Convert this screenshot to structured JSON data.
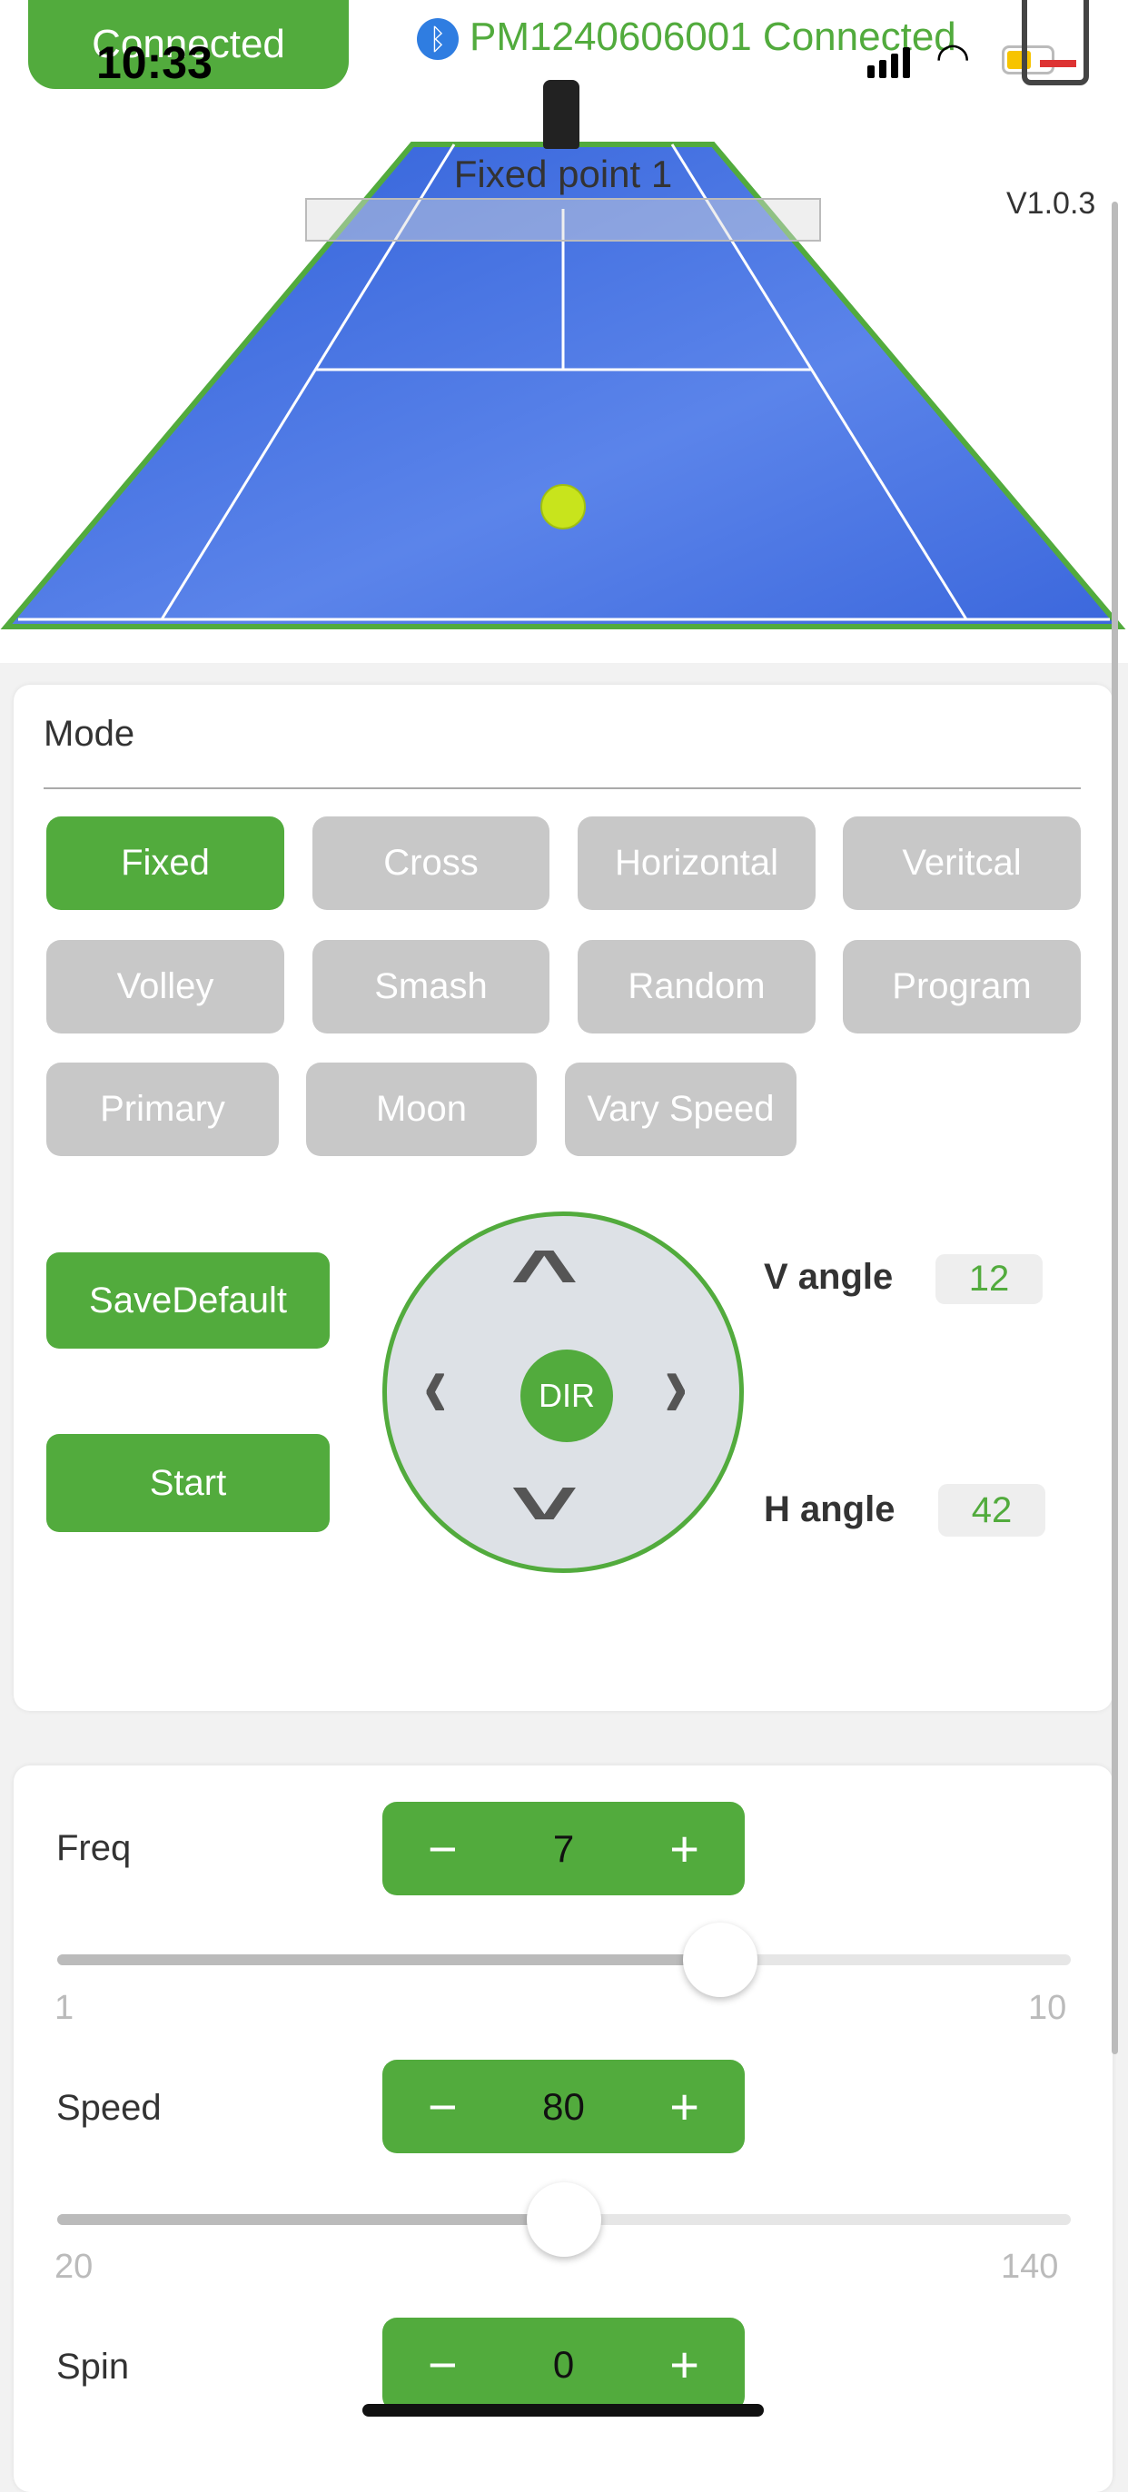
{
  "status_bar": {
    "time": "10:33",
    "battery_level": 0.45
  },
  "header": {
    "connect_button": "Connected",
    "device_status": "PM1240606001 Connected",
    "version": "V1.0.3"
  },
  "court": {
    "label": "Fixed point 1"
  },
  "mode": {
    "title": "Mode",
    "options": [
      "Fixed",
      "Cross",
      "Horizontal",
      "Veritcal",
      "Volley",
      "Smash",
      "Random",
      "Program",
      "Primary",
      "Moon",
      "Vary Speed"
    ],
    "selected": "Fixed"
  },
  "controls": {
    "save_default": "SaveDefault",
    "start": "Start",
    "dir": "DIR",
    "v_angle_label": "V angle",
    "v_angle": "12",
    "h_angle_label": "H angle",
    "h_angle": "42"
  },
  "params": [
    {
      "label": "Freq",
      "value": "7",
      "min": "1",
      "max": "10"
    },
    {
      "label": "Speed",
      "value": "80",
      "min": "20",
      "max": "140"
    },
    {
      "label": "Spin",
      "value": "0"
    }
  ],
  "colors": {
    "accent": "#52ab3d",
    "inactive": "#c8c8c8",
    "court": "#3f6ee0"
  }
}
